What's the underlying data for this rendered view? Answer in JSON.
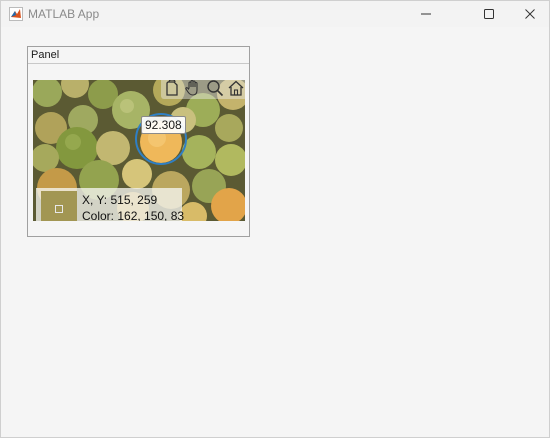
{
  "window": {
    "title": "MATLAB App",
    "controls": [
      "minimize",
      "maximize",
      "close"
    ]
  },
  "panel": {
    "title": "Panel",
    "toolbar": {
      "icons": [
        "export-icon",
        "pan-hand-icon",
        "zoom-icon",
        "home-icon"
      ]
    },
    "datatip": {
      "value": "92.308"
    },
    "pixel_info": {
      "xy_text": "X, Y: 515, 259",
      "color_text": "Color: 162, 150, 83",
      "swatch_color": "#a29653"
    },
    "image": {
      "description_icon": "fruit-image",
      "ring_color": "#2f7fc4"
    }
  }
}
